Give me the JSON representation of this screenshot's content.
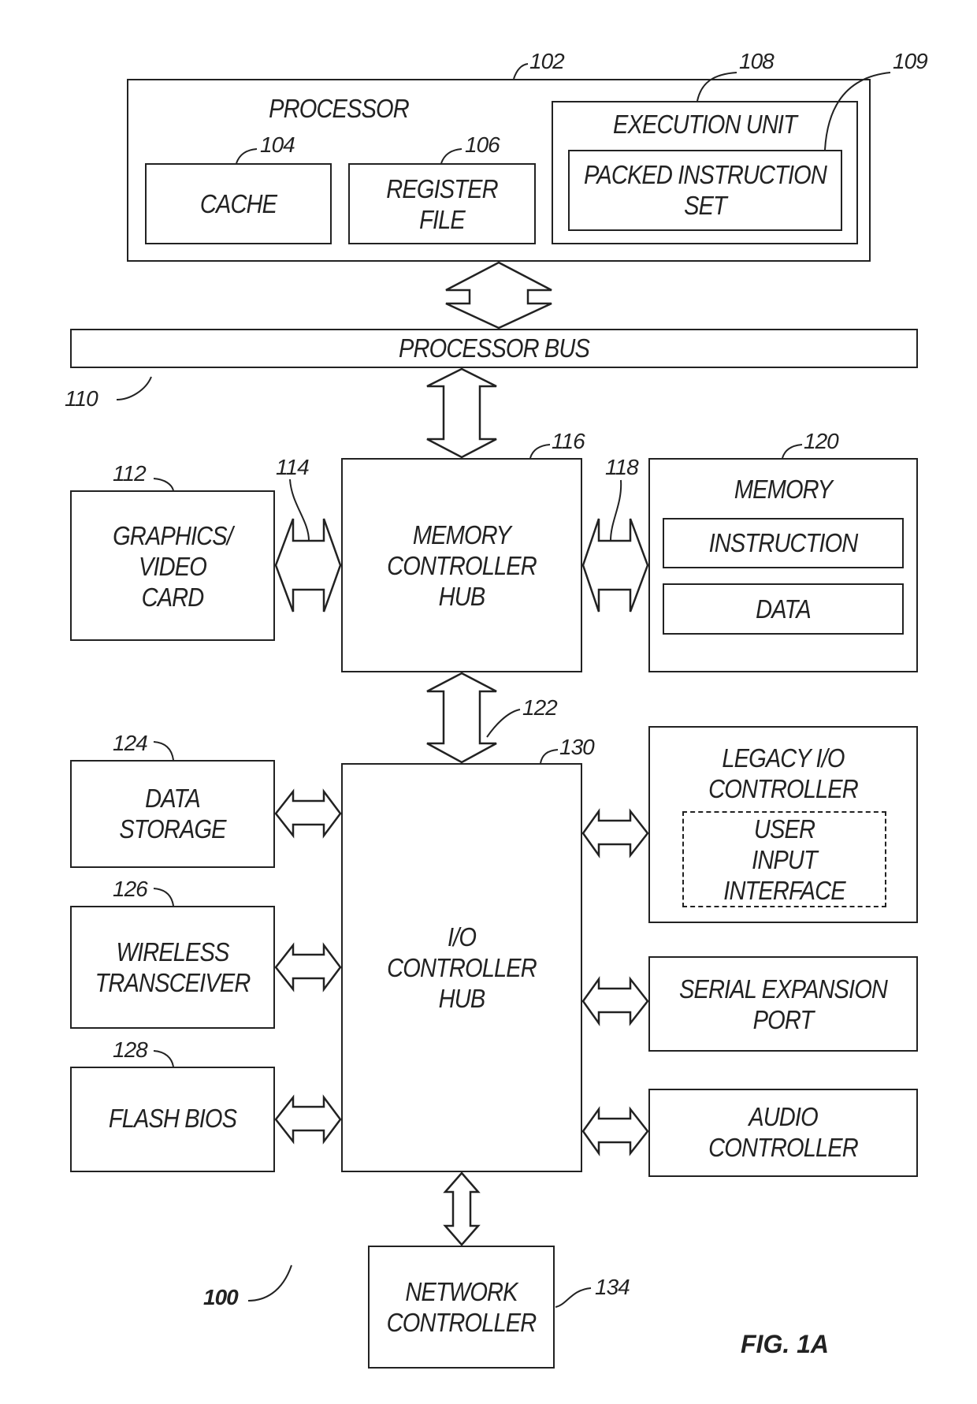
{
  "figure_label": "FIG. 1A",
  "system_ref": "100",
  "processor": {
    "ref": "102",
    "title": "PROCESSOR",
    "cache": {
      "ref": "104",
      "label": "CACHE"
    },
    "register_file": {
      "ref": "106",
      "label_line1": "REGISTER",
      "label_line2": "FILE"
    },
    "execution_unit": {
      "ref": "108",
      "label": "EXECUTION UNIT"
    },
    "packed_instruction_set": {
      "ref": "109",
      "label_line1": "PACKED INSTRUCTION",
      "label_line2": "SET"
    }
  },
  "processor_bus": {
    "ref": "110",
    "label": "PROCESSOR BUS"
  },
  "graphics_card": {
    "ref": "112",
    "label_line1": "GRAPHICS/",
    "label_line2": "VIDEO",
    "label_line3": "CARD"
  },
  "graphics_link_ref": "114",
  "memory_controller_hub": {
    "ref": "116",
    "label_line1": "MEMORY",
    "label_line2": "CONTROLLER",
    "label_line3": "HUB"
  },
  "memory_link_ref": "118",
  "memory": {
    "ref": "120",
    "title": "MEMORY",
    "instruction": "INSTRUCTION",
    "data": "DATA"
  },
  "hub_link_ref": "122",
  "data_storage": {
    "ref": "124",
    "label_line1": "DATA",
    "label_line2": "STORAGE"
  },
  "wireless_transceiver": {
    "ref": "126",
    "label_line1": "WIRELESS",
    "label_line2": "TRANSCEIVER"
  },
  "flash_bios": {
    "ref": "128",
    "label": "FLASH BIOS"
  },
  "io_controller_hub": {
    "ref": "130",
    "label_line1": "I/O",
    "label_line2": "CONTROLLER",
    "label_line3": "HUB"
  },
  "legacy_io": {
    "label_line1": "LEGACY I/O",
    "label_line2": "CONTROLLER",
    "user_input_line1": "USER",
    "user_input_line2": "INPUT",
    "user_input_line3": "INTERFACE"
  },
  "serial_port": {
    "label_line1": "SERIAL EXPANSION",
    "label_line2": "PORT"
  },
  "audio_controller": {
    "label_line1": "AUDIO",
    "label_line2": "CONTROLLER"
  },
  "network_controller": {
    "ref": "134",
    "label_line1": "NETWORK",
    "label_line2": "CONTROLLER"
  }
}
